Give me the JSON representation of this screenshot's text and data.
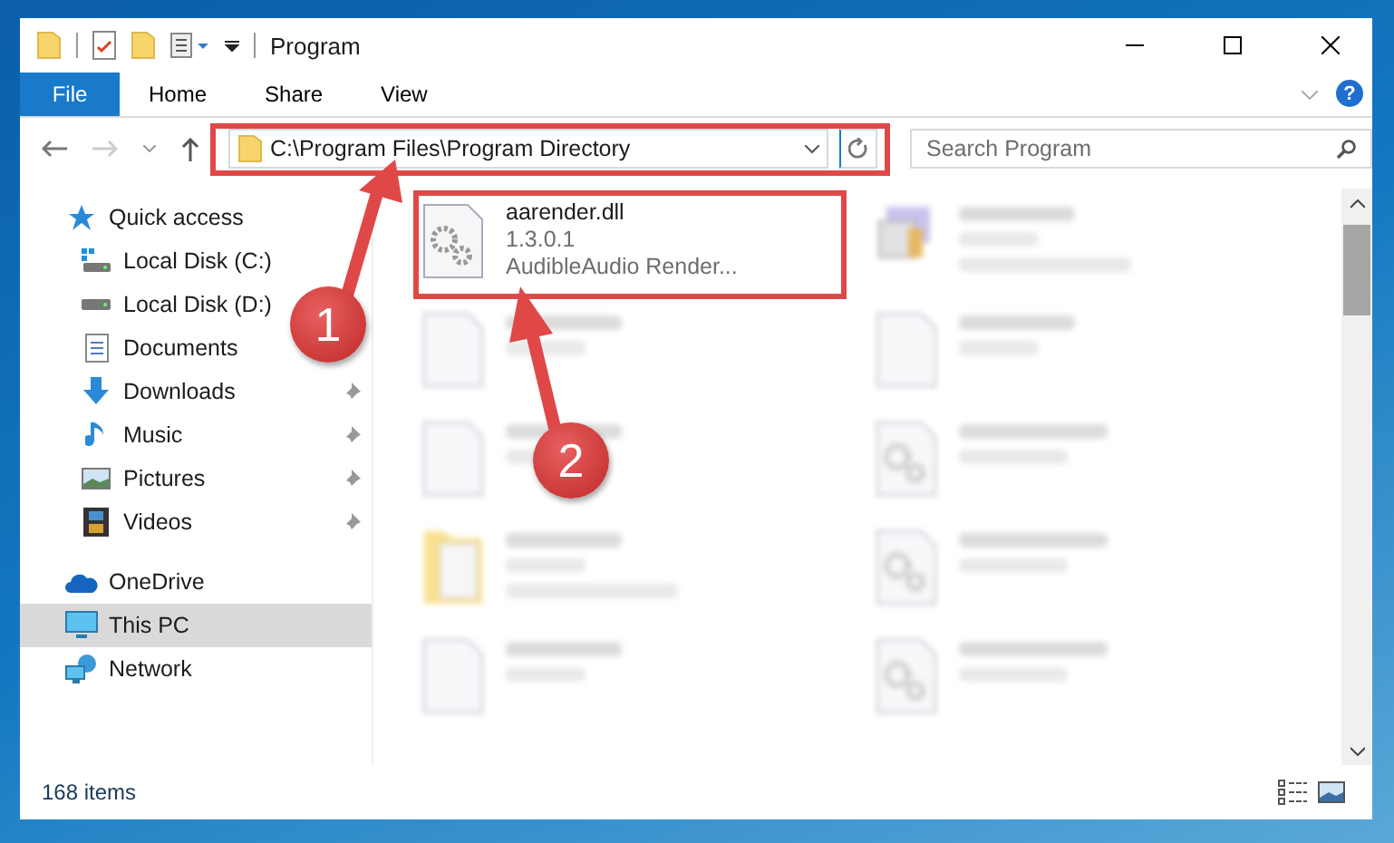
{
  "window": {
    "title": "Program"
  },
  "ribbon": {
    "file_menu": "File",
    "tabs": [
      "Home",
      "Share",
      "View"
    ],
    "help": "?"
  },
  "address": {
    "path": "C:\\Program Files\\Program Directory"
  },
  "search": {
    "placeholder": "Search Program"
  },
  "sidebar": {
    "items": [
      {
        "label": "Quick access",
        "kind": "star",
        "selected": false,
        "children": [
          {
            "label": "Local Disk (C:)",
            "kind": "windrive",
            "selected": false
          },
          {
            "label": "Local Disk (D:)",
            "kind": "drive",
            "selected": false
          },
          {
            "label": "Documents",
            "kind": "documents",
            "selected": false
          },
          {
            "label": "Downloads",
            "kind": "downloads",
            "pinned": true,
            "selected": false
          },
          {
            "label": "Music",
            "kind": "music",
            "pinned": true,
            "selected": false
          },
          {
            "label": "Pictures",
            "kind": "pictures",
            "pinned": true,
            "selected": false
          },
          {
            "label": "Videos",
            "kind": "videos",
            "pinned": true,
            "selected": false
          }
        ]
      },
      {
        "label": "OneDrive",
        "kind": "cloud",
        "selected": false
      },
      {
        "label": "This PC",
        "kind": "computer",
        "selected": true
      },
      {
        "label": "Network",
        "kind": "network",
        "selected": false
      }
    ]
  },
  "files": [
    {
      "name": "aarender.dll",
      "details": [
        "1.3.0.1",
        "AudibleAudio Render..."
      ],
      "kind": "gears",
      "blurred": false
    },
    {
      "kind": "exe",
      "blurred": true
    },
    {
      "kind": "blank",
      "blurred": true
    },
    {
      "kind": "blank",
      "blurred": true
    },
    {
      "kind": "blank",
      "blurred": true
    },
    {
      "kind": "gears",
      "blurred": true
    },
    {
      "kind": "folder",
      "blurred": true
    },
    {
      "kind": "gears",
      "blurred": true
    },
    {
      "kind": "blank",
      "blurred": true
    },
    {
      "kind": "gears",
      "blurred": true
    }
  ],
  "status_bar": {
    "count": "168 items"
  },
  "annotations": [
    {
      "number": "1"
    },
    {
      "number": "2"
    }
  ]
}
